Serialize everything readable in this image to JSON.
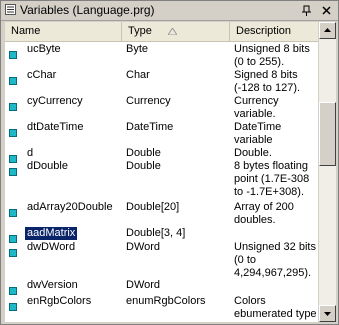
{
  "window": {
    "title": "Variables (Language.prg)"
  },
  "columns": {
    "name": "Name",
    "type": "Type",
    "description": "Description"
  },
  "colors": {
    "marker": "#1fb8c8",
    "selection": "#0a246a"
  },
  "rows": [
    {
      "name": "ucByte",
      "type": "Byte",
      "desc": [
        "Unsigned 8 bits",
        "(0 to 255)."
      ]
    },
    {
      "name": "cChar",
      "type": "Char",
      "desc": [
        "Signed 8 bits",
        "(-128 to 127)."
      ]
    },
    {
      "name": "cyCurrency",
      "type": "Currency",
      "desc": [
        "Currency",
        "variable."
      ]
    },
    {
      "name": "dtDateTime",
      "type": "DateTime",
      "desc": [
        "DateTime",
        "variable"
      ]
    },
    {
      "name": "d",
      "type": "Double",
      "desc": [
        "Double."
      ]
    },
    {
      "name": "dDouble",
      "type": "Double",
      "desc": [
        "8 bytes floating",
        "point (1.7E-308",
        "to -1.7E+308)."
      ]
    },
    {
      "name": "adArray20Double",
      "type": "Double[20]",
      "desc": [
        "Array of 200",
        "doubles."
      ]
    },
    {
      "name": "aadMatrix",
      "type": "Double[3, 4]",
      "desc": [],
      "selected": true
    },
    {
      "name": "dwDWord",
      "type": "DWord",
      "desc": [
        "Unsigned 32 bits",
        "(0 to",
        "4,294,967,295)."
      ]
    },
    {
      "name": "dwVersion",
      "type": "DWord",
      "desc": []
    },
    {
      "name": "enRgbColors",
      "type": "enumRgbColors",
      "desc": [
        "Colors",
        "ebumerated type"
      ]
    }
  ]
}
